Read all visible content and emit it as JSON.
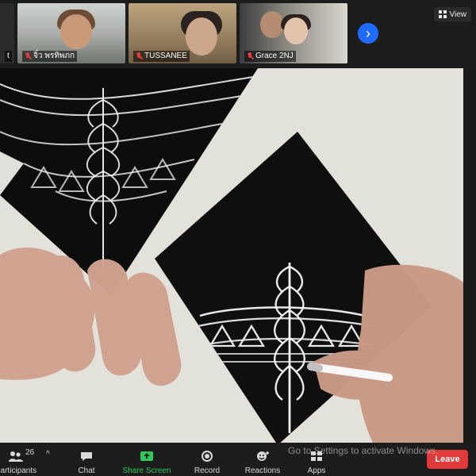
{
  "top_strip": {
    "tiles": [
      {
        "name": "t"
      },
      {
        "name": "จิ๋ว พรทิพภก"
      },
      {
        "name": "TUSSANEE"
      },
      {
        "name": "Grace 2NJ"
      }
    ],
    "next_arrow": "›",
    "view_label": "View"
  },
  "toolbar": {
    "participants_label": "Participants",
    "participants_count": "26",
    "participants_caret": "^",
    "chat_label": "Chat",
    "share_label": "Share Screen",
    "record_label": "Record",
    "reactions_label": "Reactions",
    "apps_label": "Apps",
    "leave_label": "Leave"
  },
  "watermark": {
    "text": "Go to Settings to activate Windows."
  },
  "colors": {
    "leave": "#e03a3a",
    "share_green": "#32c75a",
    "next_blue": "#1f6bff"
  }
}
